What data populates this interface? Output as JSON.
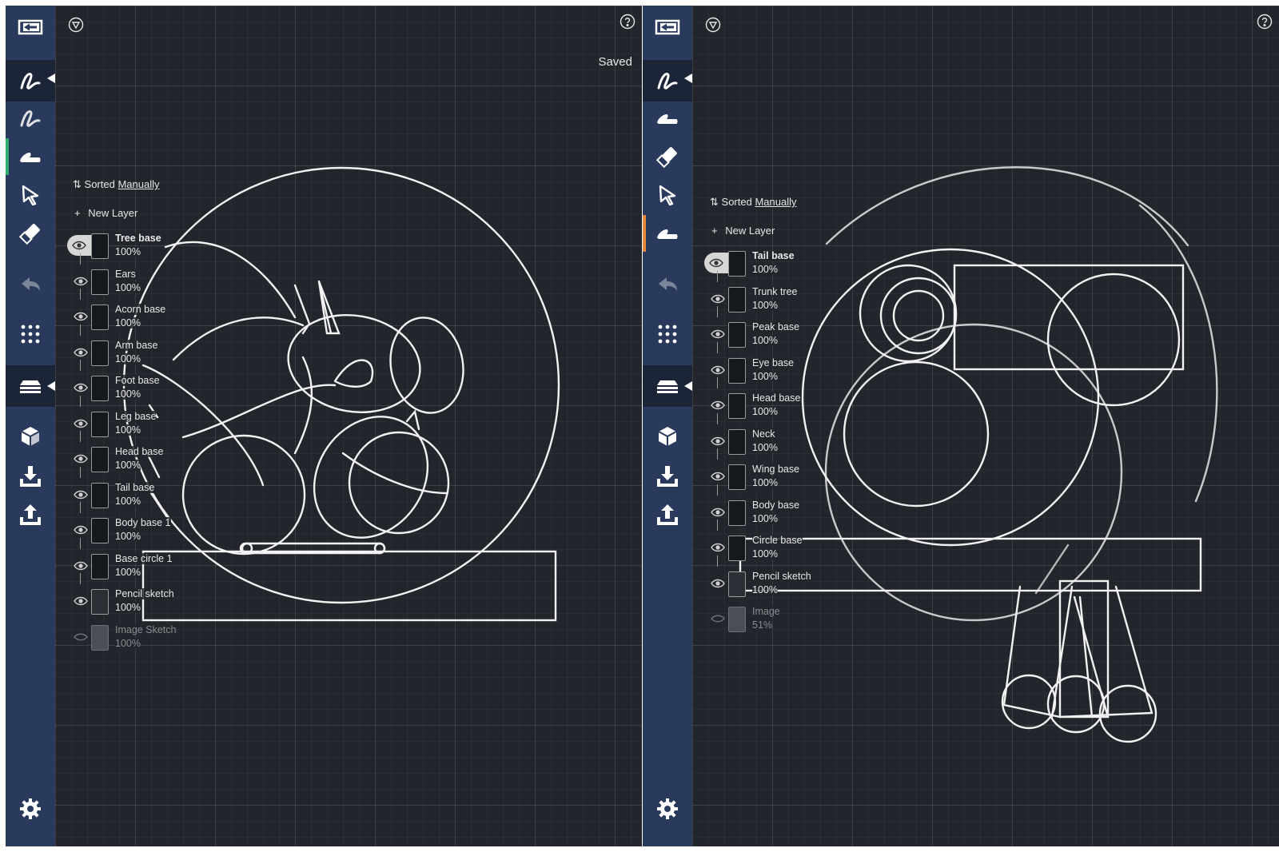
{
  "left_panel": {
    "status": "Saved",
    "sort": {
      "prefix": "Sorted",
      "mode": "Manually"
    },
    "new_layer_label": "New Layer",
    "layers": [
      {
        "name": "Tree base",
        "opacity": "100%",
        "selected": true
      },
      {
        "name": "Ears",
        "opacity": "100%"
      },
      {
        "name": "Acorn base",
        "opacity": "100%"
      },
      {
        "name": "Arm base",
        "opacity": "100%"
      },
      {
        "name": "Foot base",
        "opacity": "100%"
      },
      {
        "name": "Leg base",
        "opacity": "100%"
      },
      {
        "name": "Head base",
        "opacity": "100%"
      },
      {
        "name": "Tail base",
        "opacity": "100%"
      },
      {
        "name": "Body base 1",
        "opacity": "100%"
      },
      {
        "name": "Base circle 1",
        "opacity": "100%"
      },
      {
        "name": "Pencil sketch",
        "opacity": "100%"
      },
      {
        "name": "Image Sketch",
        "opacity": "100%",
        "hidden": true
      }
    ]
  },
  "right_panel": {
    "sort": {
      "prefix": "Sorted",
      "mode": "Manually"
    },
    "new_layer_label": "New Layer",
    "layers": [
      {
        "name": "Tail base",
        "opacity": "100%",
        "selected": true
      },
      {
        "name": "Trunk tree",
        "opacity": "100%"
      },
      {
        "name": "Peak base",
        "opacity": "100%"
      },
      {
        "name": "Eye base",
        "opacity": "100%"
      },
      {
        "name": "Head base",
        "opacity": "100%"
      },
      {
        "name": "Neck",
        "opacity": "100%"
      },
      {
        "name": "Wing base",
        "opacity": "100%"
      },
      {
        "name": "Body base",
        "opacity": "100%"
      },
      {
        "name": "Circle base",
        "opacity": "100%"
      },
      {
        "name": "Pencil sketch",
        "opacity": "100%"
      },
      {
        "name": "Image",
        "opacity": "51%",
        "hidden": true
      }
    ]
  },
  "icons": [
    "back-icon",
    "brush-icon",
    "smudge-icon",
    "selection-icon",
    "eraser-icon",
    "undo-icon",
    "grid-menu-icon",
    "layers-icon",
    "model-icon",
    "import-icon",
    "export-icon",
    "settings-icon",
    "filter-icon",
    "help-icon",
    "eye-icon"
  ],
  "colors": {
    "toolbar": "#2a3a5c",
    "canvas": "#22262c",
    "stroke": "#f2f2f2",
    "left_marker": "#2fae6f",
    "right_marker": "#e8863a"
  }
}
